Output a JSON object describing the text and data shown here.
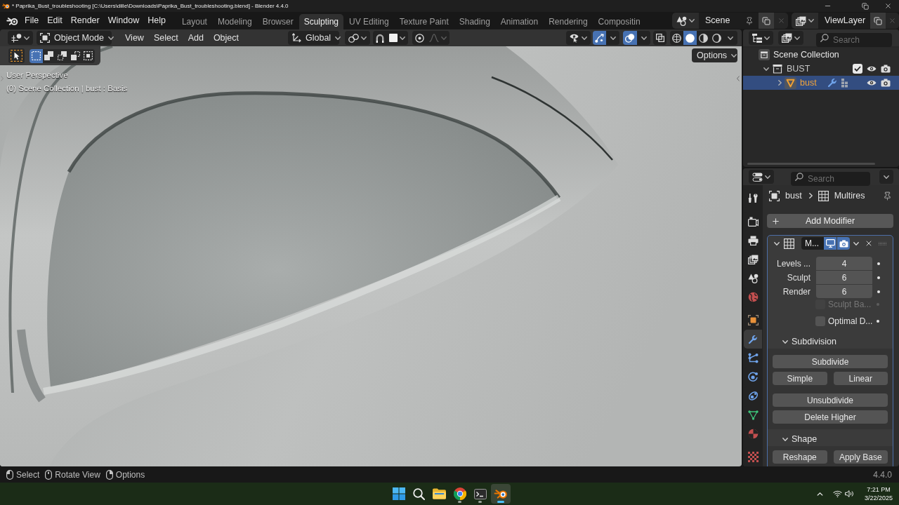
{
  "title_bar": {
    "title": "* Paprika_Bust_troubleshooting [C:\\Users\\dille\\Downloads\\Paprika_Bust_troubleshooting.blend] - Blender 4.4.0"
  },
  "menu_bar": [
    "File",
    "Edit",
    "Render",
    "Window",
    "Help"
  ],
  "workspace_tabs": [
    {
      "label": "Layout",
      "selected": false
    },
    {
      "label": "Modeling",
      "selected": false
    },
    {
      "label": "Browser",
      "selected": false
    },
    {
      "label": "Sculpting",
      "selected": true
    },
    {
      "label": "UV Editing",
      "selected": false
    },
    {
      "label": "Texture Paint",
      "selected": false
    },
    {
      "label": "Shading",
      "selected": false
    },
    {
      "label": "Animation",
      "selected": false
    },
    {
      "label": "Rendering",
      "selected": false
    },
    {
      "label": "Compositin",
      "selected": false
    }
  ],
  "scene_selector": {
    "value": "Scene"
  },
  "view_layer_selector": {
    "value": "ViewLayer"
  },
  "viewport": {
    "mode": "Object Mode",
    "menus": [
      "View",
      "Select",
      "Add",
      "Object"
    ],
    "orientation": "Global",
    "snap": {
      "on": false
    },
    "proportional_editing": {
      "on": false
    },
    "gizmos": {
      "on": true
    },
    "overlays": {
      "on": true
    },
    "xray": {
      "on": false
    },
    "shading_modes": [
      {
        "kind": "wireframe",
        "selected": false
      },
      {
        "kind": "solid",
        "selected": true
      },
      {
        "kind": "material",
        "selected": false
      },
      {
        "kind": "rendered",
        "selected": false
      }
    ],
    "select_modes": [
      {
        "kind": "set",
        "selected": true
      },
      {
        "kind": "extend",
        "selected": false
      },
      {
        "kind": "subtract",
        "selected": false
      },
      {
        "kind": "invert",
        "selected": false
      },
      {
        "kind": "intersect",
        "selected": false
      }
    ],
    "options_button": "Options",
    "info": [
      "User Perspective",
      "(0) Scene Collection | bust : Basis"
    ]
  },
  "outliner": {
    "search_placeholder": "Search",
    "tree": [
      {
        "label": "Scene Collection",
        "kind": "scene_collection",
        "selected": false,
        "children": [
          {
            "label": "BUST",
            "kind": "collection",
            "selected": false,
            "expanded": true,
            "checked": true,
            "children": [
              {
                "label": "bust",
                "kind": "mesh_object",
                "selected": true,
                "expanded": false
              }
            ]
          }
        ]
      }
    ]
  },
  "properties": {
    "search_placeholder": "Search",
    "tab_groups": [
      [
        {
          "kind": "tool",
          "selected": false
        }
      ],
      [
        {
          "kind": "render",
          "selected": false
        },
        {
          "kind": "output",
          "selected": false
        },
        {
          "kind": "view_layer",
          "selected": false
        },
        {
          "kind": "scene",
          "selected": false
        },
        {
          "kind": "world",
          "selected": false
        }
      ],
      [
        {
          "kind": "object",
          "selected": false
        },
        {
          "kind": "modifiers",
          "selected": true
        },
        {
          "kind": "particles",
          "selected": false
        },
        {
          "kind": "physics",
          "selected": false
        },
        {
          "kind": "constraints",
          "selected": false
        },
        {
          "kind": "data",
          "selected": false
        },
        {
          "kind": "material",
          "selected": false
        }
      ],
      [
        {
          "kind": "texture",
          "selected": false
        }
      ]
    ],
    "breadcrumb": [
      "bust",
      "Multires"
    ],
    "add_modifier": "Add Modifier",
    "modifier": {
      "name": "M...",
      "expanded": true,
      "show_in_viewport": true,
      "show_in_render": true,
      "fields": [
        {
          "label": "Levels ...",
          "value": "4"
        },
        {
          "label": "Sculpt",
          "value": "6"
        },
        {
          "label": "Render",
          "value": "6"
        }
      ],
      "checkboxes": [
        {
          "label": "Sculpt Ba...",
          "checked": false,
          "disabled": true
        },
        {
          "label": "Optimal D...",
          "checked": false,
          "disabled": false
        }
      ],
      "subpanels": [
        {
          "title": "Subdivision",
          "expanded": true,
          "groups": [
            [
              [
                "Subdivide"
              ],
              [
                "Simple",
                "Linear"
              ]
            ],
            [
              [
                "Unsubdivide"
              ],
              [
                "Delete Higher"
              ]
            ]
          ]
        },
        {
          "title": "Shape",
          "expanded": true,
          "groups": [
            [
              [
                "Reshape",
                "Apply Base"
              ]
            ]
          ]
        }
      ]
    }
  },
  "status_bar": {
    "hints": [
      {
        "kind": "left_click",
        "label": "Select"
      },
      {
        "kind": "middle_click",
        "label": "Rotate View"
      },
      {
        "kind": "right_click",
        "label": "Options"
      }
    ],
    "version": "4.4.0"
  },
  "taskbar": {
    "apps": [
      {
        "kind": "start",
        "active": false
      },
      {
        "kind": "search",
        "active": false
      },
      {
        "kind": "files",
        "running": false,
        "active": false
      },
      {
        "kind": "browser",
        "running": true,
        "active": false
      },
      {
        "kind": "terminal",
        "running": true,
        "active": false
      },
      {
        "kind": "blender",
        "running": true,
        "active": true
      }
    ],
    "clock": {
      "time": "7:21 PM",
      "date": "3/22/2025"
    }
  }
}
